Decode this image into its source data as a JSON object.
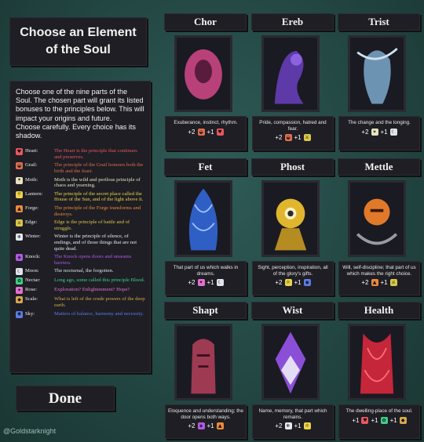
{
  "title": "Choose an Element of the Soul",
  "intro": "Choose one of the nine parts of the Soul. The chosen part will grant its listed bonuses to the principles below. This will impact your origins and future.\nChoose carefully. Every choice has its shadow.",
  "elements": [
    {
      "name": "Heart:",
      "text": "The Heart is the principle that continues and preserves.",
      "color": "#e8585e",
      "icon": "heart-icon"
    },
    {
      "name": "Grail:",
      "text": "The principle of the Grail honours both the birth and the feast.",
      "color": "#e06e4e",
      "icon": "grail-icon"
    },
    {
      "name": "Moth:",
      "text": "Moth is the wild and perilous principle of chaos and yearning.",
      "color": "#e9e2c0",
      "icon": "moth-icon"
    },
    {
      "name": "Lantern:",
      "text": "The principle of the secret place called the House of the Sun, and of the light above it.",
      "color": "#ecd34a",
      "icon": "lantern-icon"
    },
    {
      "name": "Forge:",
      "text": "The principle of the Forge transforms and destroys.",
      "color": "#ec8a3a",
      "icon": "forge-icon"
    },
    {
      "name": "Edge:",
      "text": "Edge is the principle of battle and of struggle.",
      "color": "#d9c74a",
      "icon": "edge-icon"
    },
    {
      "name": "Winter:",
      "text": "Winter is the principle of silence, of endings, and of those things that are not quite dead.",
      "color": "#e4eaf0",
      "icon": "winter-icon"
    },
    {
      "name": "Knock:",
      "text": "The Knock opens doors and unseams barriers.",
      "color": "#b25ae6",
      "icon": "knock-icon"
    },
    {
      "name": "Moon:",
      "text": "The nocturnal, the forgotten.",
      "color": "#dfe3ea",
      "icon": "moon-icon"
    },
    {
      "name": "Nectar:",
      "text": "Long ago, some called this principle Blood.",
      "color": "#3fd08a",
      "icon": "nectar-icon"
    },
    {
      "name": "Rose:",
      "text": "Exploration? Enlightenment? Hope?",
      "color": "#e470d0",
      "icon": "rose-icon"
    },
    {
      "name": "Scale:",
      "text": "What is left of the crude powers of the deep earth.",
      "color": "#d7a94a",
      "icon": "scale-icon"
    },
    {
      "name": "Sky:",
      "text": "Matters of balance, harmony and necessity.",
      "color": "#5b7de8",
      "icon": "sky-icon"
    }
  ],
  "cards": [
    {
      "title": "Chor",
      "desc": "Exuberance, instinct, rhythm.",
      "bonuses": [
        {
          "plus": "+2",
          "icon": "grail-icon",
          "color": "#e06e4e"
        },
        {
          "plus": "+1",
          "icon": "heart-icon",
          "color": "#e8585e"
        }
      ],
      "art_color": "#b8417a"
    },
    {
      "title": "Ereb",
      "desc": "Pride, compassion, hatred and fear.",
      "bonuses": [
        {
          "plus": "+2",
          "icon": "grail-icon",
          "color": "#e06e4e"
        },
        {
          "plus": "+1",
          "icon": "edge-icon",
          "color": "#d9c74a"
        }
      ],
      "art_color": "#5d3aa8"
    },
    {
      "title": "Trist",
      "desc": "The change and the longing.",
      "bonuses": [
        {
          "plus": "+2",
          "icon": "moth-icon",
          "color": "#e9e2c0"
        },
        {
          "plus": "+1",
          "icon": "moon-icon",
          "color": "#dfe3ea"
        }
      ],
      "art_color": "#6d93b3"
    },
    {
      "title": "Fet",
      "desc": "That part of us which walks in dreams.",
      "bonuses": [
        {
          "plus": "+2",
          "icon": "rose-icon",
          "color": "#e470d0"
        },
        {
          "plus": "+1",
          "icon": "moon-icon",
          "color": "#dfe3ea"
        }
      ],
      "art_color": "#2f5fc4"
    },
    {
      "title": "Phost",
      "desc": "Sight, perception, inspiration, all of the glory's gifts.",
      "bonuses": [
        {
          "plus": "+2",
          "icon": "lantern-icon",
          "color": "#ecd34a"
        },
        {
          "plus": "+1",
          "icon": "sky-icon",
          "color": "#5b7de8"
        }
      ],
      "art_color": "#e0b62e"
    },
    {
      "title": "Mettle",
      "desc": "Will, self-discipline; that part of us which makes the right choice.",
      "bonuses": [
        {
          "plus": "+2",
          "icon": "forge-icon",
          "color": "#ec8a3a"
        },
        {
          "plus": "+1",
          "icon": "edge-icon",
          "color": "#d9c74a"
        }
      ],
      "art_color": "#e07a2a"
    },
    {
      "title": "Shapt",
      "desc": "Eloquence and understanding; the door opens both ways.",
      "bonuses": [
        {
          "plus": "+2",
          "icon": "knock-icon",
          "color": "#b25ae6"
        },
        {
          "plus": "+1",
          "icon": "forge-icon",
          "color": "#ec8a3a"
        }
      ],
      "art_color": "#9e3a52"
    },
    {
      "title": "Wist",
      "desc": "Name, memory, that part which remains.",
      "bonuses": [
        {
          "plus": "+2",
          "icon": "winter-icon",
          "color": "#e4eaf0"
        },
        {
          "plus": "+1",
          "icon": "lantern-icon",
          "color": "#ecd34a"
        }
      ],
      "art_color": "#8a4fd6"
    },
    {
      "title": "Health",
      "desc": "The dwelling-place of the soul.",
      "bonuses": [
        {
          "plus": "+1",
          "icon": "heart-icon",
          "color": "#e8585e"
        },
        {
          "plus": "+1",
          "icon": "nectar-icon",
          "color": "#3fd08a"
        },
        {
          "plus": "+1",
          "icon": "scale-icon",
          "color": "#d7a94a"
        }
      ],
      "art_color": "#c6263a"
    }
  ],
  "done_label": "Done",
  "watermark": "@Goldstarknight"
}
